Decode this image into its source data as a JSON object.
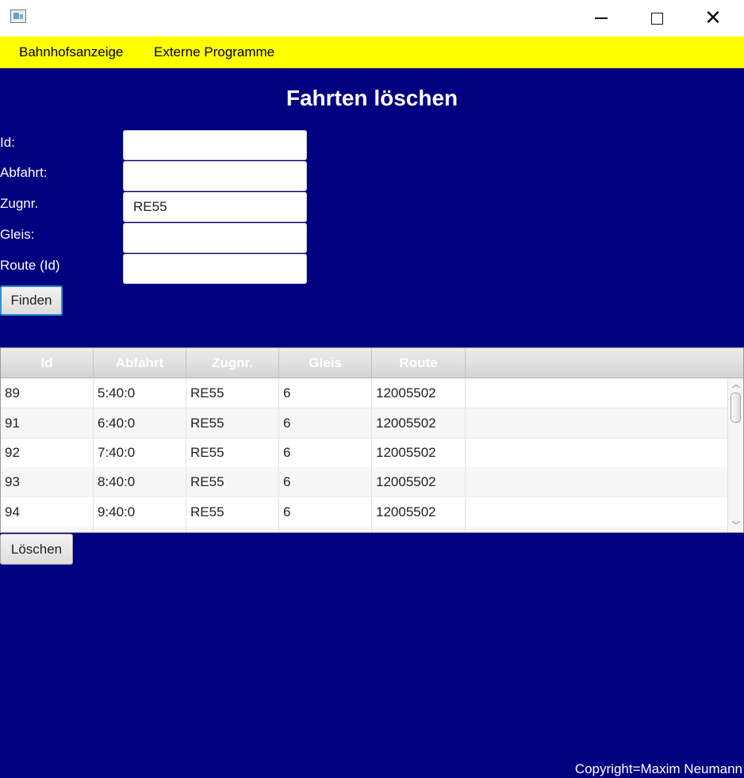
{
  "window": {
    "icons": {
      "app": "app-window-icon",
      "minimize": "minimize-icon",
      "maximize": "maximize-icon",
      "close": "close-icon"
    },
    "close_glyph": "✕"
  },
  "menubar": {
    "background": "#ffff00",
    "items": [
      {
        "label": "Bahnhofsanzeige"
      },
      {
        "label": "Externe Programme"
      }
    ]
  },
  "page": {
    "title": "Fahrten löschen",
    "background": "#000080"
  },
  "form": {
    "fields": [
      {
        "label": "Id:",
        "value": ""
      },
      {
        "label": "Abfahrt:",
        "value": ""
      },
      {
        "label": "Zugnr.",
        "value": "RE55"
      },
      {
        "label": "Gleis:",
        "value": ""
      },
      {
        "label": "Route (Id)",
        "value": ""
      }
    ],
    "find_button": "Finden"
  },
  "table": {
    "columns": [
      "Id",
      "Abfahrt",
      "Zugnr.",
      "Gleis",
      "Route"
    ],
    "rows": [
      [
        "89",
        "5:40:0",
        "RE55",
        "6",
        "12005502"
      ],
      [
        "91",
        "6:40:0",
        "RE55",
        "6",
        "12005502"
      ],
      [
        "92",
        "7:40:0",
        "RE55",
        "6",
        "12005502"
      ],
      [
        "93",
        "8:40:0",
        "RE55",
        "6",
        "12005502"
      ],
      [
        "94",
        "9:40:0",
        "RE55",
        "6",
        "12005502"
      ],
      [
        "",
        "",
        "",
        "",
        ""
      ]
    ],
    "scroll_up_glyph": "︿",
    "scroll_down_glyph": "﹀"
  },
  "actions": {
    "delete_button": "Löschen"
  },
  "footer": {
    "copyright": "Copyright=Maxim Neumann"
  }
}
